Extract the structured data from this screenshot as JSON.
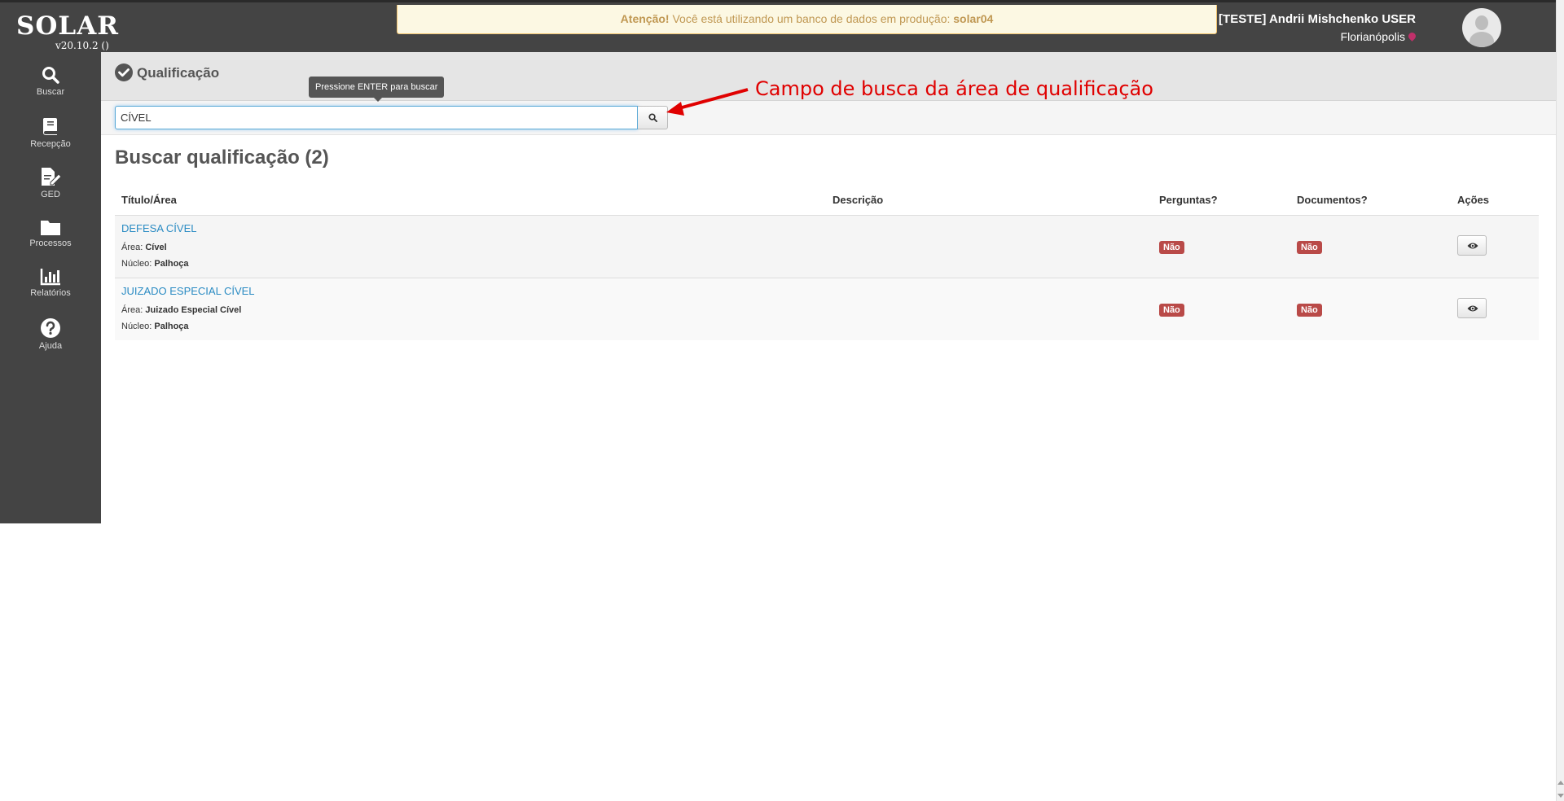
{
  "brand": {
    "name": "SOLAR",
    "version": "v20.10.2 ()"
  },
  "alert": {
    "strong": "Atenção!",
    "text": "Você está utilizando um banco de dados em produção:",
    "db": "solar04",
    "bg_color": "#fcf8e3"
  },
  "user": {
    "name": "[TESTE] Andrii Mishchenko USER",
    "city": "Florianópolis",
    "avatar_icon": "user-avatar-icon"
  },
  "sidebar": {
    "items": [
      {
        "label": "Buscar",
        "icon": "search-icon"
      },
      {
        "label": "Recepção",
        "icon": "book-icon"
      },
      {
        "label": "GED",
        "icon": "document-edit-icon"
      },
      {
        "label": "Processos",
        "icon": "folder-icon"
      },
      {
        "label": "Relatórios",
        "icon": "bar-chart-icon"
      },
      {
        "label": "Ajuda",
        "icon": "help-icon"
      }
    ]
  },
  "page": {
    "title": "Qualificação",
    "title_icon": "check-circle-icon"
  },
  "search": {
    "value": "CÍVEL",
    "tooltip": "Pressione ENTER para buscar"
  },
  "annotation": {
    "text": "Campo de busca da área de qualificação",
    "color": "#e00000"
  },
  "results": {
    "title": "Buscar qualificação (2)",
    "columns": [
      "Título/Área",
      "Descrição",
      "Perguntas?",
      "Documentos?",
      "Ações"
    ],
    "area_label": "Área:",
    "nucleo_label": "Núcleo:",
    "rows": [
      {
        "title": "DEFESA CÍVEL",
        "area": "Cível",
        "nucleo": "Palhoça",
        "descricao": "",
        "perguntas": "Não",
        "documentos": "Não"
      },
      {
        "title": "JUIZADO ESPECIAL CÍVEL",
        "area": "Juizado Especial Cível",
        "nucleo": "Palhoça",
        "descricao": "",
        "perguntas": "Não",
        "documentos": "Não"
      }
    ]
  }
}
